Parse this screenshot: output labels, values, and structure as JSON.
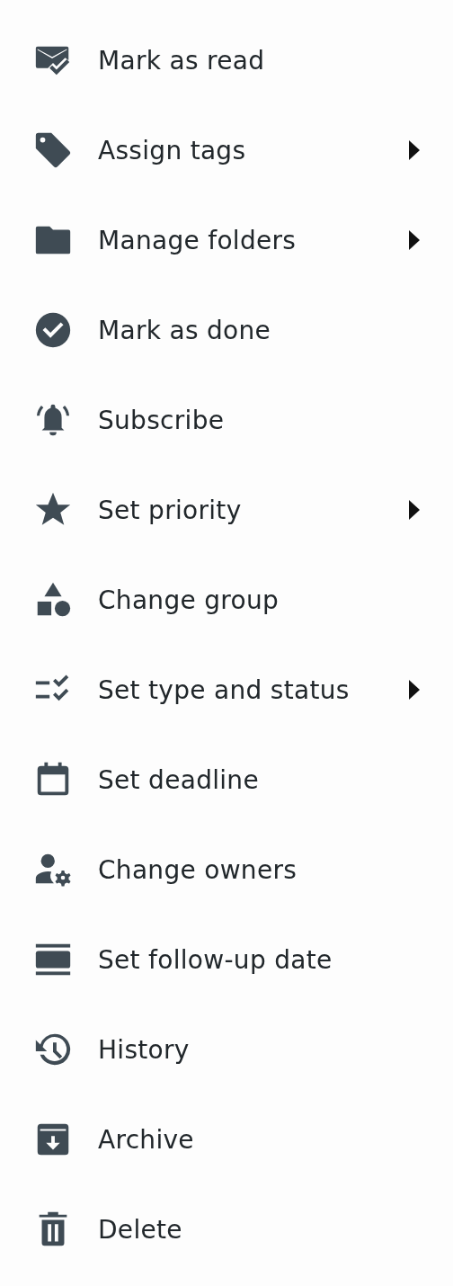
{
  "menu": {
    "items": [
      {
        "label": "Mark as read",
        "submenu": false
      },
      {
        "label": "Assign tags",
        "submenu": true
      },
      {
        "label": "Manage folders",
        "submenu": true
      },
      {
        "label": "Mark as done",
        "submenu": false
      },
      {
        "label": "Subscribe",
        "submenu": false
      },
      {
        "label": "Set priority",
        "submenu": true
      },
      {
        "label": "Change group",
        "submenu": false
      },
      {
        "label": "Set type and status",
        "submenu": true
      },
      {
        "label": "Set deadline",
        "submenu": false
      },
      {
        "label": "Change owners",
        "submenu": false
      },
      {
        "label": "Set follow-up date",
        "submenu": false
      },
      {
        "label": "History",
        "submenu": false
      },
      {
        "label": "Archive",
        "submenu": false
      },
      {
        "label": "Delete",
        "submenu": false
      }
    ]
  }
}
